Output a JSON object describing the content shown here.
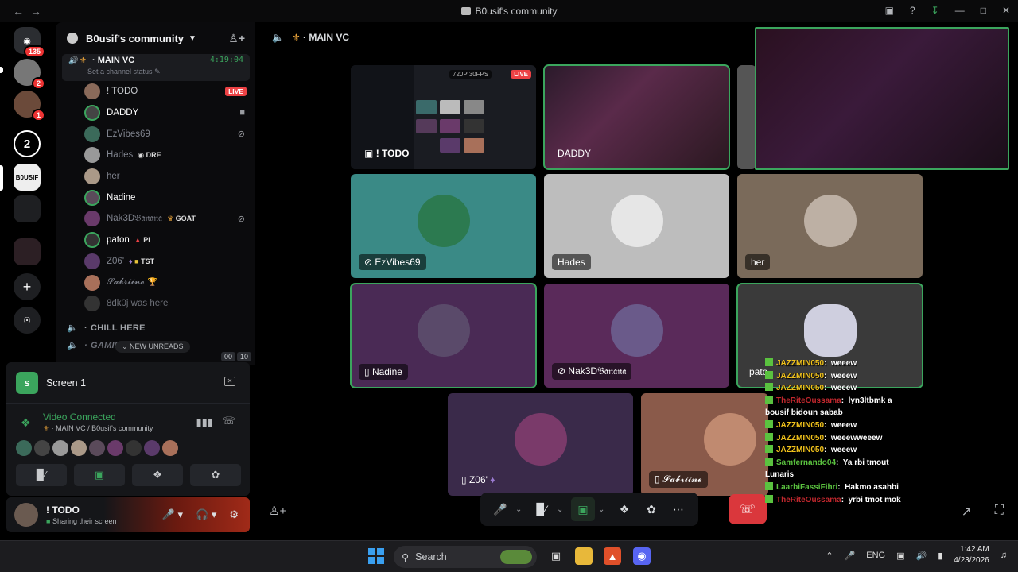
{
  "window": {
    "title": "B0usif's community"
  },
  "servers": {
    "dm_badge": "135",
    "badge2": "2",
    "badge3": "1",
    "server_label": "B0USIF"
  },
  "sidebar": {
    "guild_name": "B0usif's community",
    "main_vc": {
      "name": "MAIN VC",
      "time": "4:19:04",
      "status": "Set a channel status"
    },
    "members": [
      {
        "name": "! TODO",
        "extra": "LIVE"
      },
      {
        "name": "DADDY",
        "extra": ""
      },
      {
        "name": "EzVibes69",
        "extra": ""
      },
      {
        "name": "Hades",
        "extra": "DRE"
      },
      {
        "name": "her",
        "extra": ""
      },
      {
        "name": "Nadine",
        "extra": ""
      },
      {
        "name": "Nak3D𝔅𝔞𝔫𝔞𝔫𝔞",
        "extra": "GOAT"
      },
      {
        "name": "paton",
        "extra": "PL"
      },
      {
        "name": "Z06'",
        "extra": "TST"
      },
      {
        "name": "𝓢𝓪𝓫𝓻𝓲𝓲𝓷𝓮",
        "extra": ""
      },
      {
        "name": "8dk0j was here",
        "extra": ""
      }
    ],
    "chill": "CHILL HERE",
    "gaming": "GAMING ZO...",
    "new_unreads": "NEW UNREADS",
    "count_a": "00",
    "count_b": "10"
  },
  "panel": {
    "screen_title": "Screen 1",
    "video_connected": "Video Connected",
    "location": "MAIN VC / B0usif's community"
  },
  "user": {
    "name": "! TODO",
    "status": "Sharing their screen"
  },
  "main": {
    "title": "MAIN VC",
    "tiles": [
      {
        "name": "! TODO"
      },
      {
        "name": "DADDY"
      },
      {
        "name": "EzVibes69"
      },
      {
        "name": "Hades"
      },
      {
        "name": "her"
      },
      {
        "name": "Nadine"
      },
      {
        "name": "Nak3D𝔅𝔞𝔫𝔞𝔫𝔞"
      },
      {
        "name": "pato"
      },
      {
        "name": "Z06'"
      },
      {
        "name": "𝓢𝓪𝓫𝓻𝓲𝓲𝓷𝓮"
      }
    ],
    "stream_quality": "720P 30FPS",
    "stream_live": "LIVE"
  },
  "chat": [
    {
      "user": "JAZZMIN050",
      "msg": "weeew",
      "color": "#f1c21b"
    },
    {
      "user": "JAZZMIN050",
      "msg": "weeew",
      "color": "#f1c21b"
    },
    {
      "user": "JAZZMIN050",
      "msg": "weeew",
      "color": "#f1c21b"
    },
    {
      "user": "TheRiteOussama",
      "msg": "lyn3ltbmk a bousif bidoun sabab",
      "color": "#c3282e"
    },
    {
      "user": "JAZZMIN050",
      "msg": "weeew",
      "color": "#f1c21b"
    },
    {
      "user": "JAZZMIN050",
      "msg": "weeewweeew",
      "color": "#f1c21b"
    },
    {
      "user": "JAZZMIN050",
      "msg": "weeew",
      "color": "#f1c21b"
    },
    {
      "user": "Samfernando04",
      "msg": "Ya rbi tmout Lunaris",
      "color": "#5ac23f"
    },
    {
      "user": "LaarbiFassiFihri",
      "msg": "Hakmo asahbi",
      "color": "#5ac23f"
    },
    {
      "user": "TheRiteOussama",
      "msg": "yrbi tmot mok",
      "color": "#c3282e"
    }
  ],
  "taskbar": {
    "search": "Search",
    "lang": "ENG",
    "time": "1:42 AM",
    "date": "4/23/2026"
  }
}
